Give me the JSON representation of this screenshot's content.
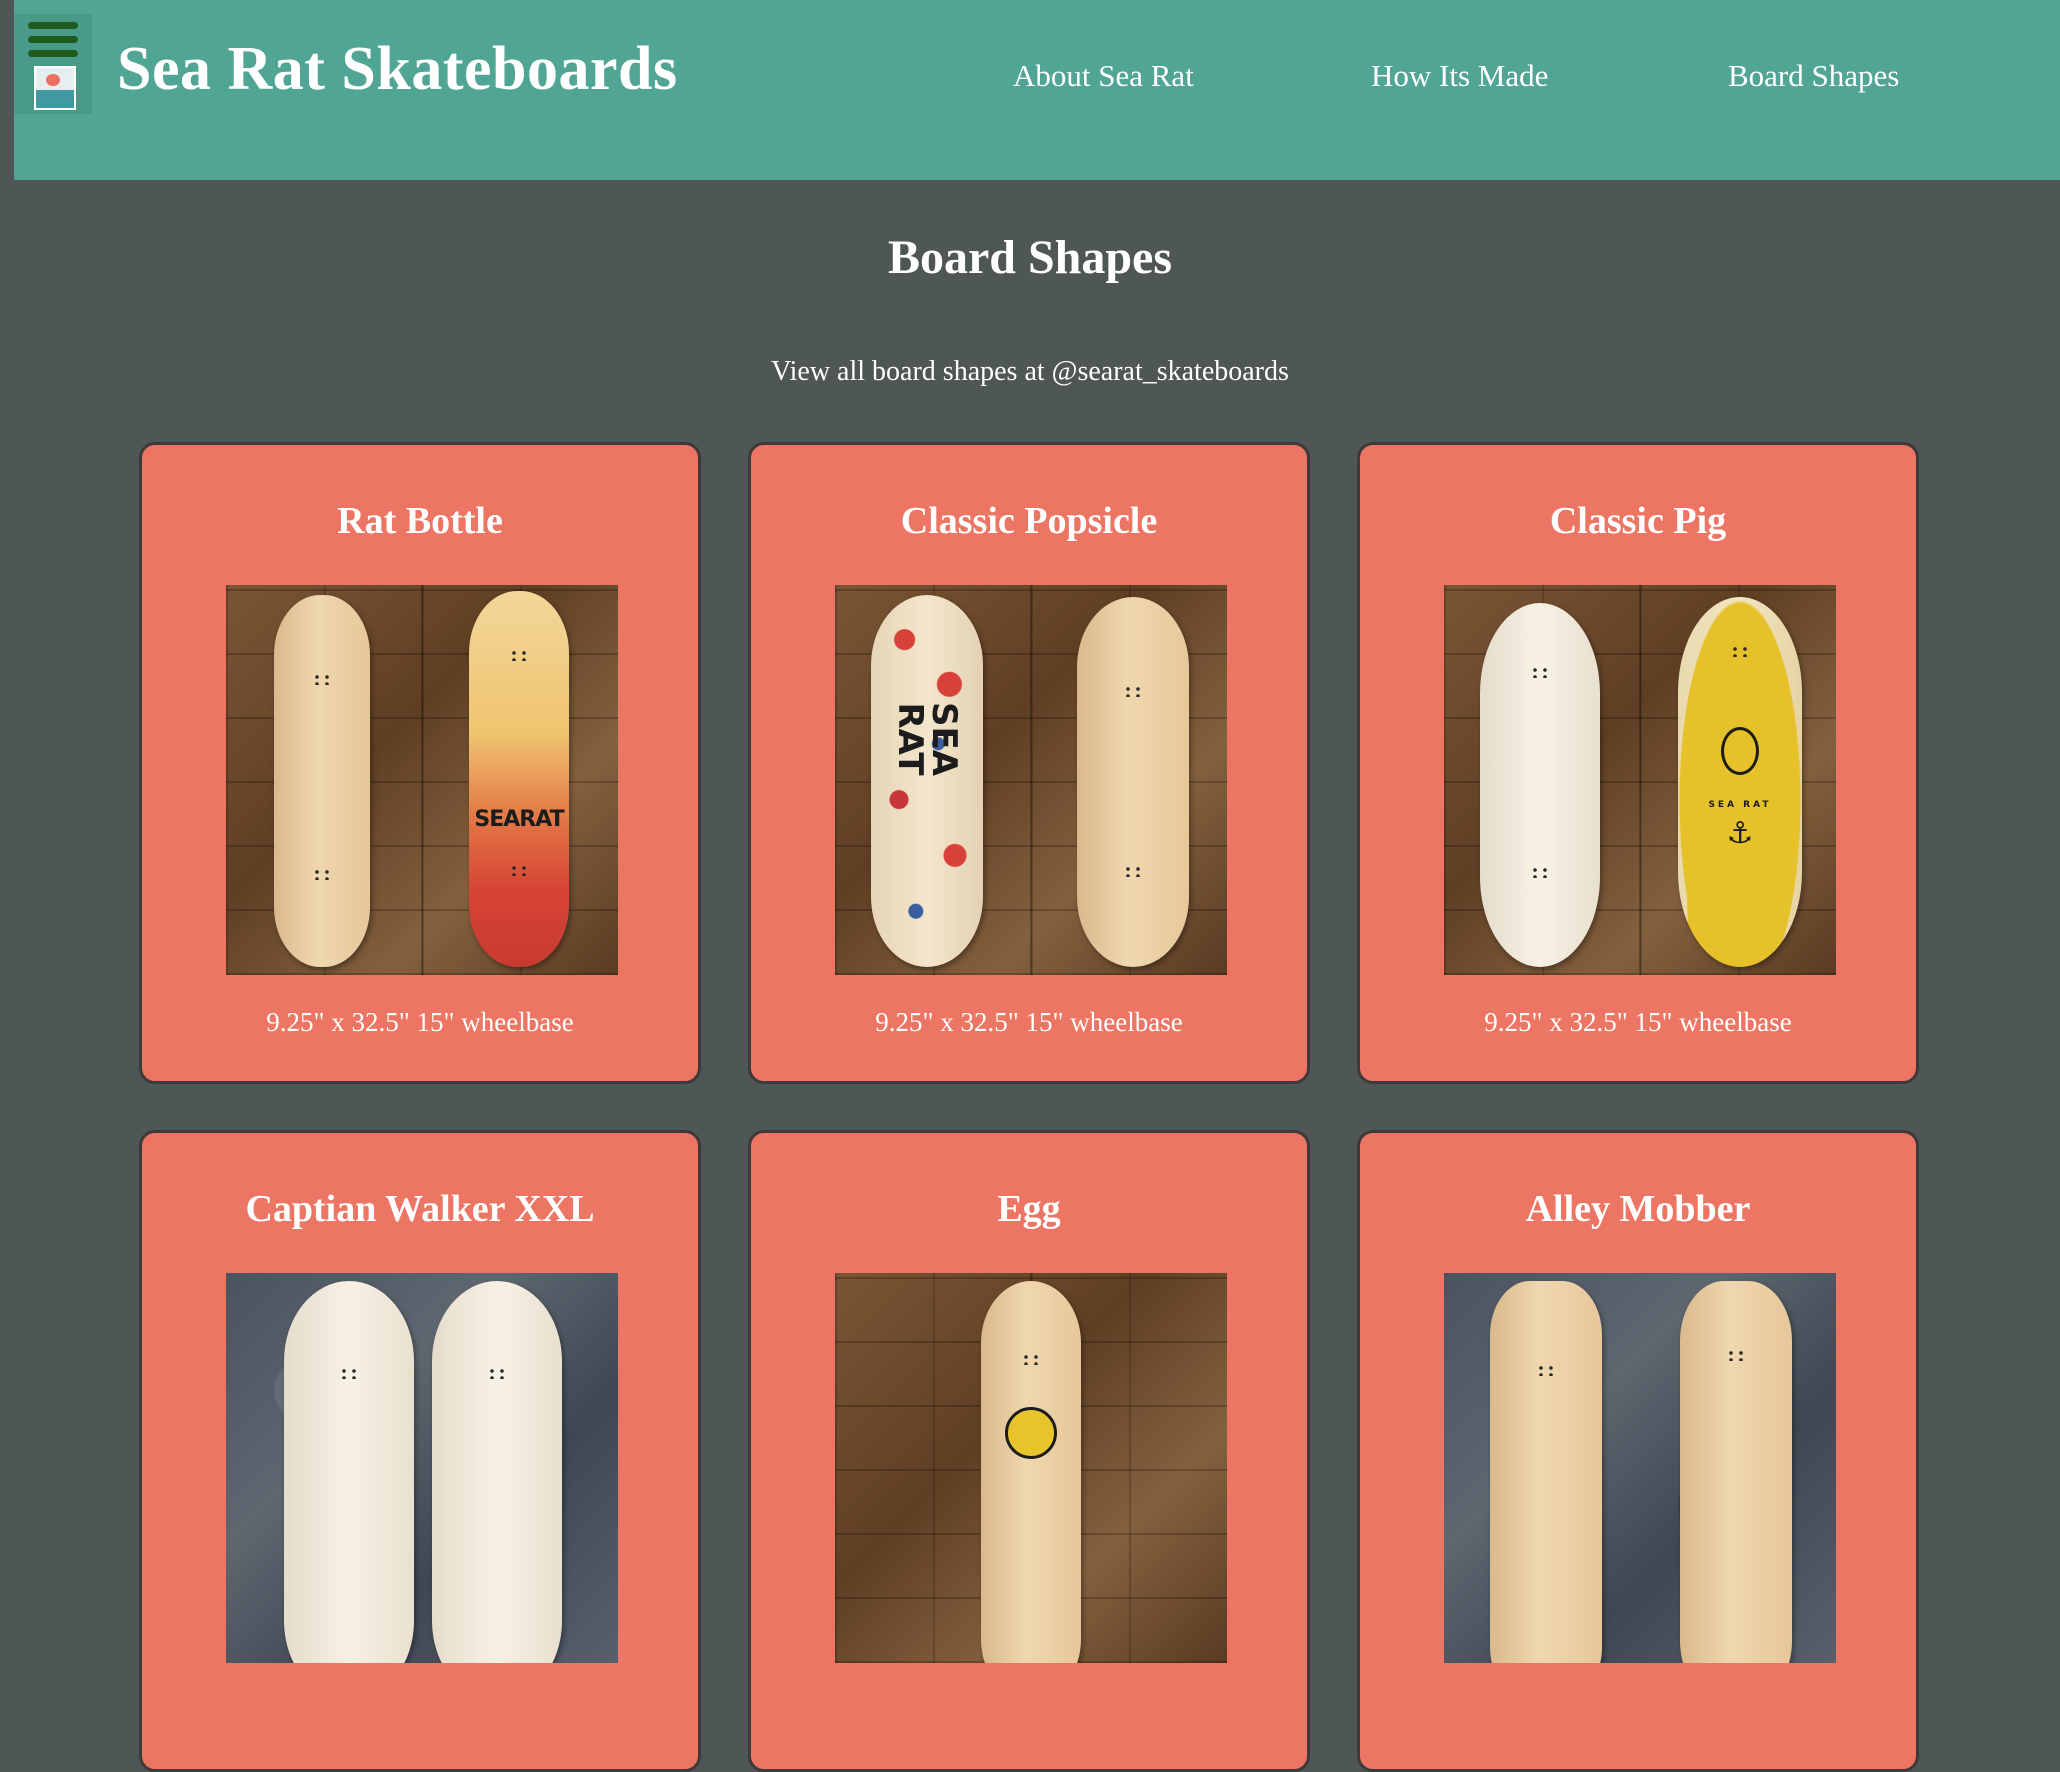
{
  "header": {
    "site_title": "Sea Rat Skateboards",
    "nav": [
      {
        "label": "About Sea Rat"
      },
      {
        "label": "How Its Made"
      },
      {
        "label": "Board Shapes"
      }
    ],
    "background_color": "#51a594"
  },
  "main": {
    "heading": "Board Shapes",
    "subheading": "View all board shapes at @searat_skateboards",
    "background_color": "#4f5656"
  },
  "cards": [
    {
      "title": "Rat Bottle",
      "dims": "9.25\" x 32.5\" 15\" wheelbase",
      "deck_print": "SEARAT"
    },
    {
      "title": "Classic Popsicle",
      "dims": "9.25\" x 32.5\" 15\" wheelbase",
      "deck_print": "SEA RAT"
    },
    {
      "title": "Classic Pig",
      "dims": "9.25\" x 32.5\" 15\" wheelbase",
      "deck_print": "SEA RAT"
    },
    {
      "title": "Captian Walker XXL"
    },
    {
      "title": "Egg"
    },
    {
      "title": "Alley Mobber"
    }
  ],
  "theme": {
    "card_color": "#ec7563",
    "card_border": "#3f3a3a",
    "text_color": "#ffffff",
    "menu_icon_color": "#1f5a1f"
  },
  "icons": {
    "menu": "hamburger-icon",
    "logo": "sea-rat-logo"
  }
}
